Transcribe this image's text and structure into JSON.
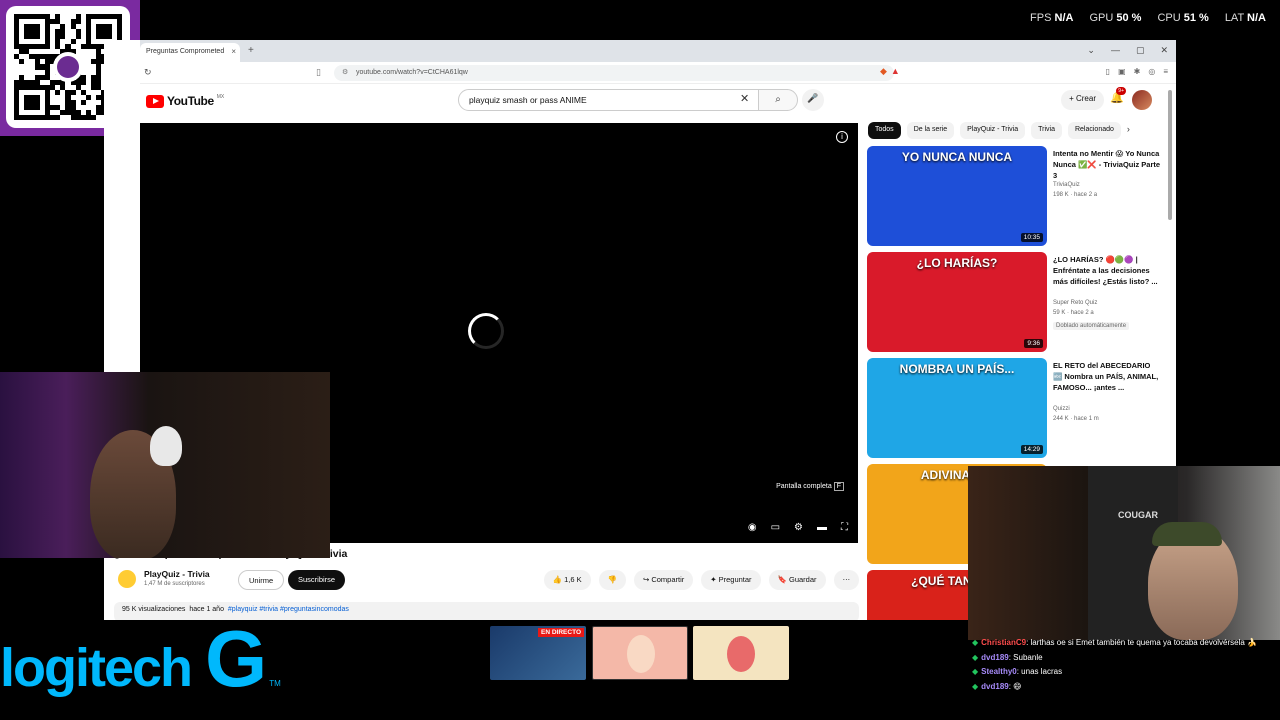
{
  "stats": [
    {
      "label": "FPS",
      "value": "N/A"
    },
    {
      "label": "GPU",
      "value": "50 %"
    },
    {
      "label": "CPU",
      "value": "51 %"
    },
    {
      "label": "LAT",
      "value": "N/A"
    }
  ],
  "qr": {
    "logo_text": "yape"
  },
  "browser": {
    "tab_title": "Preguntas Comprometed",
    "tab_close": "×",
    "new_tab": "+",
    "win_controls": [
      "⌄",
      "—",
      "▢",
      "✕"
    ],
    "url": "youtube.com/watch?v=CtCHA61lqw",
    "reload_icon": "↻"
  },
  "youtube": {
    "logo": "YouTube",
    "region": "MX",
    "search_value": "playquiz smash or pass ANIME",
    "clear": "✕",
    "search_icon": "⌕",
    "mic_icon": "🎤",
    "crear": "+ Crear",
    "notif_count": "9+",
    "video": {
      "info": "i",
      "fullscreen_tip": "Pantalla completa",
      "fullscreen_key": "F",
      "title": "¿Cuántas podrás responder? - Play Quiz Trivia",
      "channel": "PlayQuiz - Trivia",
      "subscribers": "1,47 M de suscriptores",
      "join": "Unirme",
      "subscribe": "Suscribirse",
      "likes": "👍 1,6 K",
      "dislike": "👎",
      "share": "↪ Compartir",
      "ask": "✦ Preguntar",
      "save": "🔖 Guardar",
      "more": "⋯",
      "views": "95 K visualizaciones",
      "age": "hace 1 año",
      "tags": "#playquiz #trivia #preguntasincomodas"
    },
    "chips": [
      "Todos",
      "De la serie",
      "PlayQuiz - Trivia",
      "Trivia",
      "Relacionado"
    ],
    "recs": [
      {
        "thumb": "YO NUNCA NUNCA",
        "bg": "#1e4fd8",
        "duration": "10:35",
        "title": "Intenta no Mentir 😱 Yo Nunca Nunca ✅❌ - TriviaQuiz Parte 3",
        "channel": "TriviaQuiz",
        "meta": "198 K · hace 2 a",
        "extra": ""
      },
      {
        "thumb": "¿LO HARÍAS?",
        "bg": "#d91a2a",
        "duration": "9:36",
        "title": "¿LO HARÍAS? 🔴🟢🟣 | Enfréntate a las decisiones más difíciles! ¿Estás listo? ...",
        "channel": "Super Reto Quiz",
        "meta": "59 K · hace 2 a",
        "extra": "Doblado automáticamente"
      },
      {
        "thumb": "NOMBRA UN PAÍS...",
        "bg": "#1fa6e6",
        "duration": "14:29",
        "title": "EL RETO del ABECEDARIO 🔤 Nombra un PAÍS, ANIMAL, FAMOSO... ¡antes ...",
        "channel": "Quizzi",
        "meta": "244 K · hace 1 m",
        "extra": ""
      },
      {
        "thumb": "ADIVINA 200",
        "bg": "#f2a51a",
        "duration": "",
        "title": "",
        "channel": "",
        "meta": "",
        "extra": ""
      },
      {
        "thumb": "¿QUÉ TAN TÓXI",
        "bg": "#d9221a",
        "duration": "",
        "title": "",
        "channel": "",
        "meta": "",
        "extra": ""
      }
    ]
  },
  "overlay": {
    "brand": "logitech",
    "brand_g": "G",
    "tm": "TM",
    "live_badge": "EN DIRECTO",
    "chair_brand": "COUGAR"
  },
  "chat": [
    {
      "user": "ChristianC9",
      "color": "#ff4d4d",
      "text": ": larthas oe si Emet también te quema ya tocaba devolvérsela 🍌"
    },
    {
      "user": "dvd189",
      "color": "#a78bfa",
      "text": ": Subanle"
    },
    {
      "user": "Stealthy0",
      "color": "#a78bfa",
      "text": ": unas lacras"
    },
    {
      "user": "dvd189",
      "color": "#a78bfa",
      "text": ": 😄"
    }
  ]
}
